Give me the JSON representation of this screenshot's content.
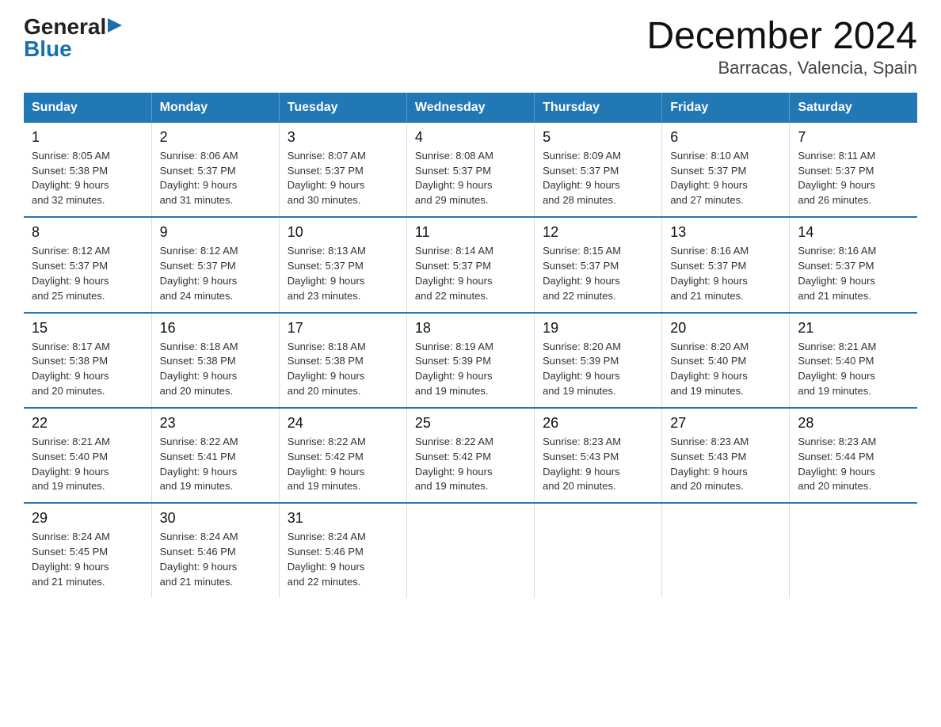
{
  "logo": {
    "general": "General",
    "blue": "Blue",
    "arrow": "▶"
  },
  "title": {
    "month_year": "December 2024",
    "location": "Barracas, Valencia, Spain"
  },
  "headers": [
    "Sunday",
    "Monday",
    "Tuesday",
    "Wednesday",
    "Thursday",
    "Friday",
    "Saturday"
  ],
  "weeks": [
    [
      {
        "day": "1",
        "sunrise": "8:05 AM",
        "sunset": "5:38 PM",
        "daylight": "9 hours and 32 minutes."
      },
      {
        "day": "2",
        "sunrise": "8:06 AM",
        "sunset": "5:37 PM",
        "daylight": "9 hours and 31 minutes."
      },
      {
        "day": "3",
        "sunrise": "8:07 AM",
        "sunset": "5:37 PM",
        "daylight": "9 hours and 30 minutes."
      },
      {
        "day": "4",
        "sunrise": "8:08 AM",
        "sunset": "5:37 PM",
        "daylight": "9 hours and 29 minutes."
      },
      {
        "day": "5",
        "sunrise": "8:09 AM",
        "sunset": "5:37 PM",
        "daylight": "9 hours and 28 minutes."
      },
      {
        "day": "6",
        "sunrise": "8:10 AM",
        "sunset": "5:37 PM",
        "daylight": "9 hours and 27 minutes."
      },
      {
        "day": "7",
        "sunrise": "8:11 AM",
        "sunset": "5:37 PM",
        "daylight": "9 hours and 26 minutes."
      }
    ],
    [
      {
        "day": "8",
        "sunrise": "8:12 AM",
        "sunset": "5:37 PM",
        "daylight": "9 hours and 25 minutes."
      },
      {
        "day": "9",
        "sunrise": "8:12 AM",
        "sunset": "5:37 PM",
        "daylight": "9 hours and 24 minutes."
      },
      {
        "day": "10",
        "sunrise": "8:13 AM",
        "sunset": "5:37 PM",
        "daylight": "9 hours and 23 minutes."
      },
      {
        "day": "11",
        "sunrise": "8:14 AM",
        "sunset": "5:37 PM",
        "daylight": "9 hours and 22 minutes."
      },
      {
        "day": "12",
        "sunrise": "8:15 AM",
        "sunset": "5:37 PM",
        "daylight": "9 hours and 22 minutes."
      },
      {
        "day": "13",
        "sunrise": "8:16 AM",
        "sunset": "5:37 PM",
        "daylight": "9 hours and 21 minutes."
      },
      {
        "day": "14",
        "sunrise": "8:16 AM",
        "sunset": "5:37 PM",
        "daylight": "9 hours and 21 minutes."
      }
    ],
    [
      {
        "day": "15",
        "sunrise": "8:17 AM",
        "sunset": "5:38 PM",
        "daylight": "9 hours and 20 minutes."
      },
      {
        "day": "16",
        "sunrise": "8:18 AM",
        "sunset": "5:38 PM",
        "daylight": "9 hours and 20 minutes."
      },
      {
        "day": "17",
        "sunrise": "8:18 AM",
        "sunset": "5:38 PM",
        "daylight": "9 hours and 20 minutes."
      },
      {
        "day": "18",
        "sunrise": "8:19 AM",
        "sunset": "5:39 PM",
        "daylight": "9 hours and 19 minutes."
      },
      {
        "day": "19",
        "sunrise": "8:20 AM",
        "sunset": "5:39 PM",
        "daylight": "9 hours and 19 minutes."
      },
      {
        "day": "20",
        "sunrise": "8:20 AM",
        "sunset": "5:40 PM",
        "daylight": "9 hours and 19 minutes."
      },
      {
        "day": "21",
        "sunrise": "8:21 AM",
        "sunset": "5:40 PM",
        "daylight": "9 hours and 19 minutes."
      }
    ],
    [
      {
        "day": "22",
        "sunrise": "8:21 AM",
        "sunset": "5:40 PM",
        "daylight": "9 hours and 19 minutes."
      },
      {
        "day": "23",
        "sunrise": "8:22 AM",
        "sunset": "5:41 PM",
        "daylight": "9 hours and 19 minutes."
      },
      {
        "day": "24",
        "sunrise": "8:22 AM",
        "sunset": "5:42 PM",
        "daylight": "9 hours and 19 minutes."
      },
      {
        "day": "25",
        "sunrise": "8:22 AM",
        "sunset": "5:42 PM",
        "daylight": "9 hours and 19 minutes."
      },
      {
        "day": "26",
        "sunrise": "8:23 AM",
        "sunset": "5:43 PM",
        "daylight": "9 hours and 20 minutes."
      },
      {
        "day": "27",
        "sunrise": "8:23 AM",
        "sunset": "5:43 PM",
        "daylight": "9 hours and 20 minutes."
      },
      {
        "day": "28",
        "sunrise": "8:23 AM",
        "sunset": "5:44 PM",
        "daylight": "9 hours and 20 minutes."
      }
    ],
    [
      {
        "day": "29",
        "sunrise": "8:24 AM",
        "sunset": "5:45 PM",
        "daylight": "9 hours and 21 minutes."
      },
      {
        "day": "30",
        "sunrise": "8:24 AM",
        "sunset": "5:46 PM",
        "daylight": "9 hours and 21 minutes."
      },
      {
        "day": "31",
        "sunrise": "8:24 AM",
        "sunset": "5:46 PM",
        "daylight": "9 hours and 22 minutes."
      },
      null,
      null,
      null,
      null
    ]
  ]
}
